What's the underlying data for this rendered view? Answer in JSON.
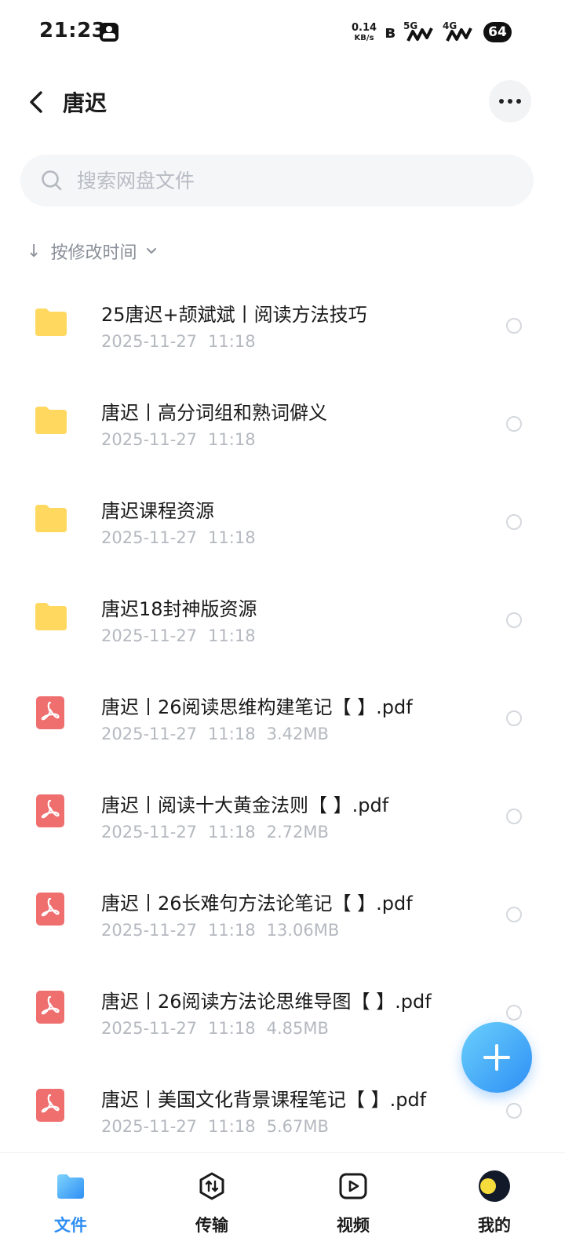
{
  "status_bar": {
    "time": "21:23",
    "net_speed_value": "0.14",
    "net_speed_unit": "KB/s",
    "signal_1_label": "5G",
    "signal_2_label": "4G",
    "battery_level": "64"
  },
  "header": {
    "title": "唐迟"
  },
  "search": {
    "placeholder": "搜索网盘文件"
  },
  "sort": {
    "label": "按修改时间"
  },
  "files": [
    {
      "type": "folder",
      "name": "25唐迟+颉斌斌丨阅读方法技巧",
      "date": "2025-11-27",
      "time": "11:18",
      "size": ""
    },
    {
      "type": "folder",
      "name": "唐迟丨高分词组和熟词僻义",
      "date": "2025-11-27",
      "time": "11:18",
      "size": ""
    },
    {
      "type": "folder",
      "name": "唐迟课程资源",
      "date": "2025-11-27",
      "time": "11:18",
      "size": ""
    },
    {
      "type": "folder",
      "name": "唐迟18封神版资源",
      "date": "2025-11-27",
      "time": "11:18",
      "size": ""
    },
    {
      "type": "pdf",
      "name": "唐迟丨26阅读思维构建笔记【 】.pdf",
      "date": "2025-11-27",
      "time": "11:18",
      "size": "3.42MB"
    },
    {
      "type": "pdf",
      "name": "唐迟丨阅读十大黄金法则【 】.pdf",
      "date": "2025-11-27",
      "time": "11:18",
      "size": "2.72MB"
    },
    {
      "type": "pdf",
      "name": "唐迟丨26长难句方法论笔记【 】.pdf",
      "date": "2025-11-27",
      "time": "11:18",
      "size": "13.06MB"
    },
    {
      "type": "pdf",
      "name": "唐迟丨26阅读方法论思维导图【 】.pdf",
      "date": "2025-11-27",
      "time": "11:18",
      "size": "4.85MB"
    },
    {
      "type": "pdf",
      "name": "唐迟丨美国文化背景课程笔记【 】.pdf",
      "date": "2025-11-27",
      "time": "11:18",
      "size": "5.67MB"
    }
  ],
  "nav": {
    "files_label": "文件",
    "transfer_label": "传输",
    "video_label": "视频",
    "me_label": "我的"
  },
  "colors": {
    "accent": "#2d8df4",
    "folder": "#ffd860",
    "pdf": "#ef6f6f"
  },
  "icons": {
    "back": "chevron-left-icon",
    "more": "more-horizontal-icon",
    "search": "search-icon",
    "fab": "plus-icon"
  }
}
